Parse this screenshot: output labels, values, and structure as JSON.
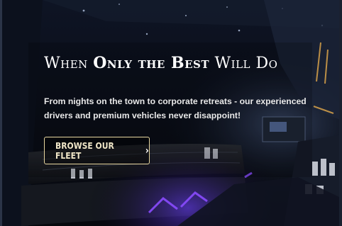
{
  "hero": {
    "headline": {
      "part1": "When ",
      "bold": "Only the Best",
      "part2": " Will Do"
    },
    "subtext": "From nights on the town to corporate retreats - our experienced drivers and premium vehicles never disappoint!",
    "cta_label": "BROWSE OUR FLEET",
    "cta_icon": "chevron-right-icon"
  },
  "colors": {
    "accent_border": "#e8d7a0",
    "text": "#ffffff",
    "led_purple": "#8a4cff",
    "background": "#0b0f1a"
  }
}
